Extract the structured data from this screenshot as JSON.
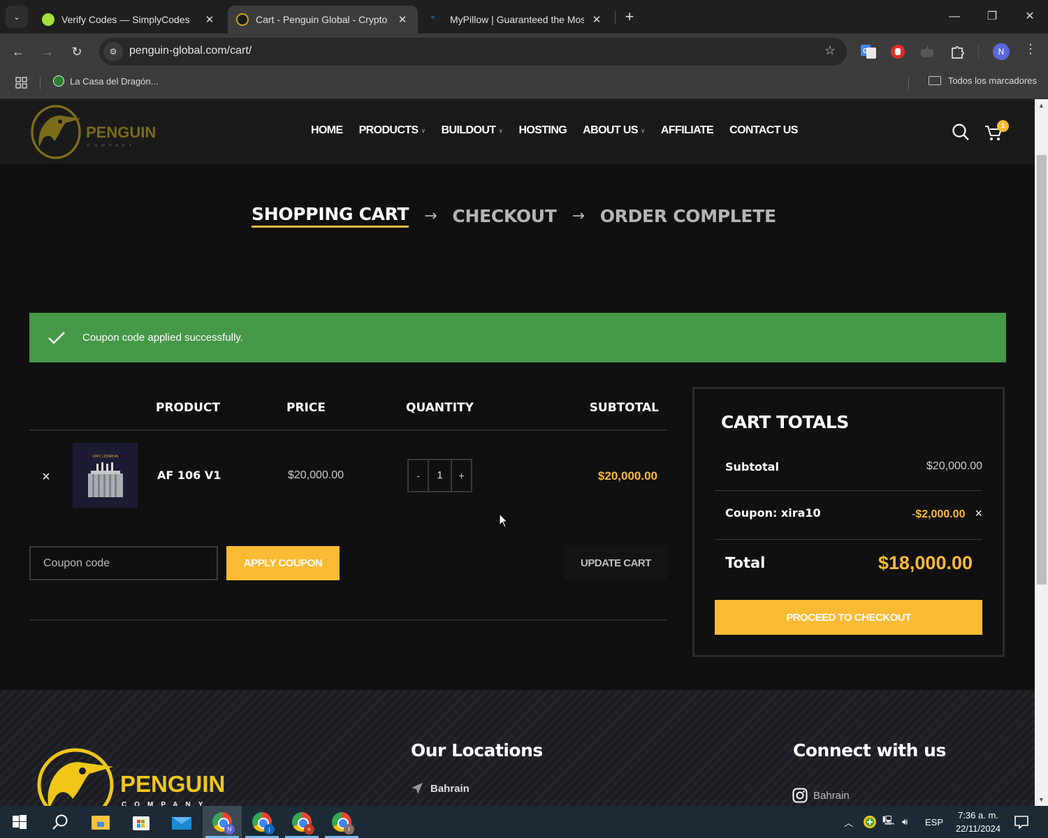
{
  "browser": {
    "tabs": [
      {
        "title": "Verify Codes — SimplyCodes",
        "favicon": "simplycodes-icon",
        "active": false
      },
      {
        "title": "Cart - Penguin Global - Crypto Mining",
        "favicon": "penguin-icon",
        "active": true
      },
      {
        "title": "MyPillow | Guaranteed the Most Comfortable",
        "favicon": "mypillow-icon",
        "active": false
      }
    ],
    "url": "penguin-global.com/cart/",
    "profile_initial": "N",
    "bookmarks": [
      {
        "label": "La Casa del Dragón..."
      }
    ],
    "all_bookmarks_label": "Todos los marcadores"
  },
  "site": {
    "brand": {
      "name": "PENGUIN",
      "tagline": "C O M P A N Y"
    },
    "nav": [
      {
        "label": "HOME",
        "dropdown": false
      },
      {
        "label": "PRODUCTS",
        "dropdown": true
      },
      {
        "label": "BUILDOUT",
        "dropdown": true
      },
      {
        "label": "HOSTING",
        "dropdown": false
      },
      {
        "label": "ABOUT US",
        "dropdown": true
      },
      {
        "label": "AFFILIATE",
        "dropdown": false
      },
      {
        "label": "CONTACT US",
        "dropdown": false
      }
    ],
    "cart_count": "1",
    "accent_color": "#fbba34"
  },
  "steps": [
    {
      "label": "SHOPPING CART",
      "current": true
    },
    {
      "label": "CHECKOUT",
      "current": false
    },
    {
      "label": "ORDER COMPLETE",
      "current": false
    }
  ],
  "step_arrow": "→",
  "notice": {
    "message": "Coupon code applied successfully.",
    "color": "#449848"
  },
  "cart": {
    "columns": {
      "product": "PRODUCT",
      "price": "PRICE",
      "quantity": "QUANTITY",
      "subtotal": "SUBTOTAL"
    },
    "items": [
      {
        "name": "AF 106 V1",
        "image_label": "10KV | 2500KVA",
        "price": "$20,000.00",
        "quantity": "1",
        "subtotal": "$20,000.00"
      }
    ],
    "qty_minus": "-",
    "qty_plus": "+",
    "remove_glyph": "×",
    "coupon_placeholder": "Coupon code",
    "coupon_value": "",
    "apply_coupon_label": "APPLY COUPON",
    "update_cart_label": "UPDATE CART"
  },
  "totals": {
    "title": "CART TOTALS",
    "subtotal_label": "Subtotal",
    "subtotal_value": "$20,000.00",
    "coupon_label": "Coupon: xira10",
    "coupon_minus": "-",
    "coupon_value": "$2,000.00",
    "coupon_remove": "×",
    "total_label": "Total",
    "total_value": "$18,000.00",
    "checkout_label": "PROCEED TO CHECKOUT"
  },
  "footer": {
    "brand": {
      "name": "PENGUIN",
      "tagline": "C O M P A N Y"
    },
    "locations_title": "Our Locations",
    "locations": [
      "Bahrain"
    ],
    "connect_title": "Connect with us",
    "social": [
      {
        "icon": "instagram-icon",
        "label": "Bahrain"
      }
    ]
  },
  "taskbar": {
    "chrome_profiles": [
      "N",
      "j",
      "n",
      "I"
    ],
    "language": "ESP",
    "time": "7:36 a. m.",
    "date": "22/11/2024"
  }
}
